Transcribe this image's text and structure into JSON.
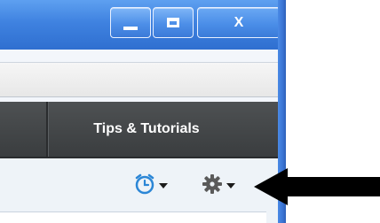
{
  "window": {
    "controls": {
      "minimize_icon": "minimize-icon",
      "maximize_icon": "maximize-icon",
      "close_label": "X"
    }
  },
  "navbar": {
    "tab_label": "Tips & Tutorials"
  },
  "toolbar": {
    "alarm_icon": "alarm-clock-icon",
    "settings_icon": "gear-icon"
  },
  "colors": {
    "titlebar": "#3f82e0",
    "navbar": "#45484a",
    "toolbar_bg": "#eef3f8",
    "alarm_icon": "#2b86d6",
    "gear_icon": "#5a5a5a",
    "arrow": "#000000"
  }
}
